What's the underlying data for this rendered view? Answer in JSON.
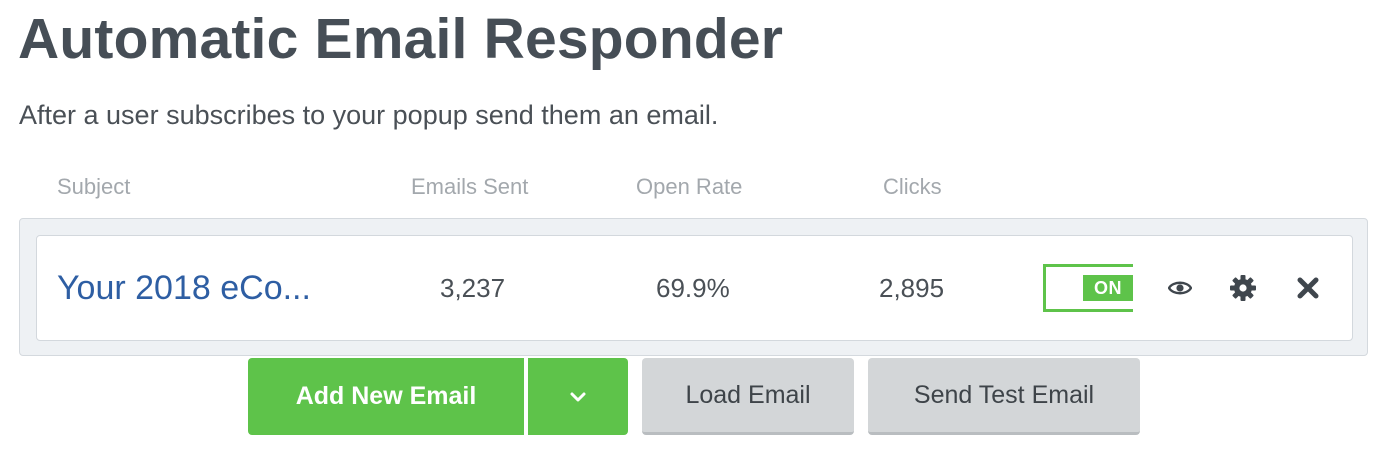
{
  "page": {
    "title": "Automatic Email Responder",
    "subtitle": "After a user subscribes to your popup send them an email."
  },
  "table": {
    "headers": {
      "subject": "Subject",
      "emails_sent": "Emails Sent",
      "open_rate": "Open Rate",
      "clicks": "Clicks"
    },
    "rows": [
      {
        "subject": "Your 2018 eCo...",
        "emails_sent": "3,237",
        "open_rate": "69.9%",
        "clicks": "2,895",
        "toggle_label": "ON",
        "toggle_state": "on"
      }
    ]
  },
  "actions": {
    "add_new_email": "Add New Email",
    "load_email": "Load Email",
    "send_test_email": "Send Test Email"
  },
  "icons": {
    "preview": "eye-icon",
    "settings": "gear-icon",
    "delete": "close-icon",
    "dropdown": "chevron-down-icon"
  },
  "colors": {
    "accent_green": "#5ec34a",
    "link_blue": "#2e5ea3",
    "title_text": "#464e56",
    "muted_header": "#a3a8ad",
    "secondary_button": "#d3d6d8"
  }
}
